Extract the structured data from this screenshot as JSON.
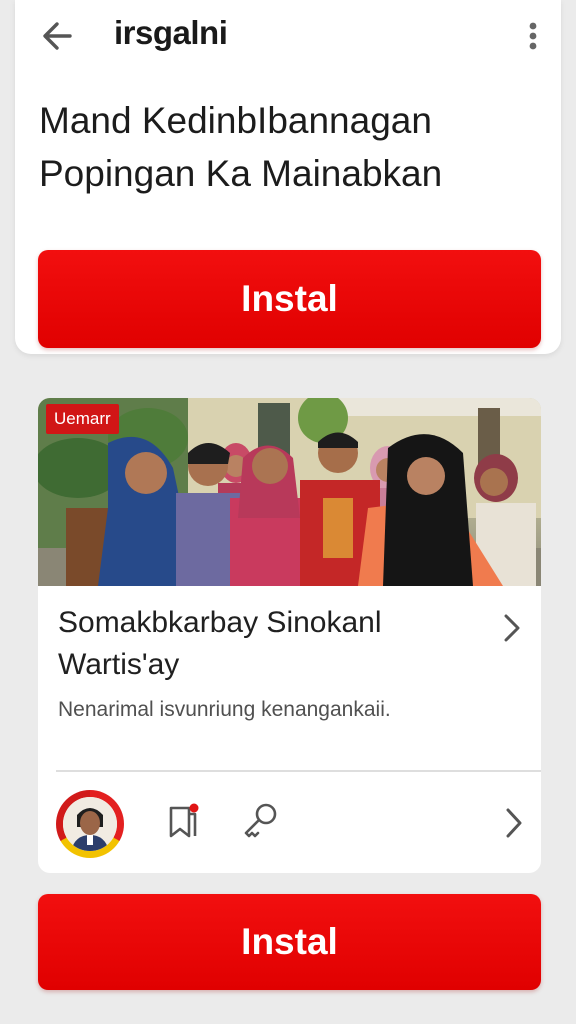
{
  "header": {
    "title": "irsgalni",
    "back_icon": "arrow-left-icon",
    "menu_icon": "more-vertical-icon"
  },
  "headline": {
    "line1": "Mand KedinbIbannagan",
    "line2": "Popingan Ka Mainabkan"
  },
  "install_top": {
    "label": "Instal"
  },
  "post": {
    "photo_badge": "Uemarr",
    "title_line1": "Somakbkarbay Sinokanl",
    "title_line2": "Wartis'ay",
    "description": "Nenarimal isvunriung kenangankaii.",
    "actions": {
      "bookmark_icon": "bookmark-icon",
      "key_icon": "key-icon",
      "chevron_icon": "chevron-right-icon"
    }
  },
  "install_bottom": {
    "label": "Instal"
  },
  "colors": {
    "accent_red": "#e00000",
    "background": "#ebebeb",
    "card": "#ffffff"
  }
}
